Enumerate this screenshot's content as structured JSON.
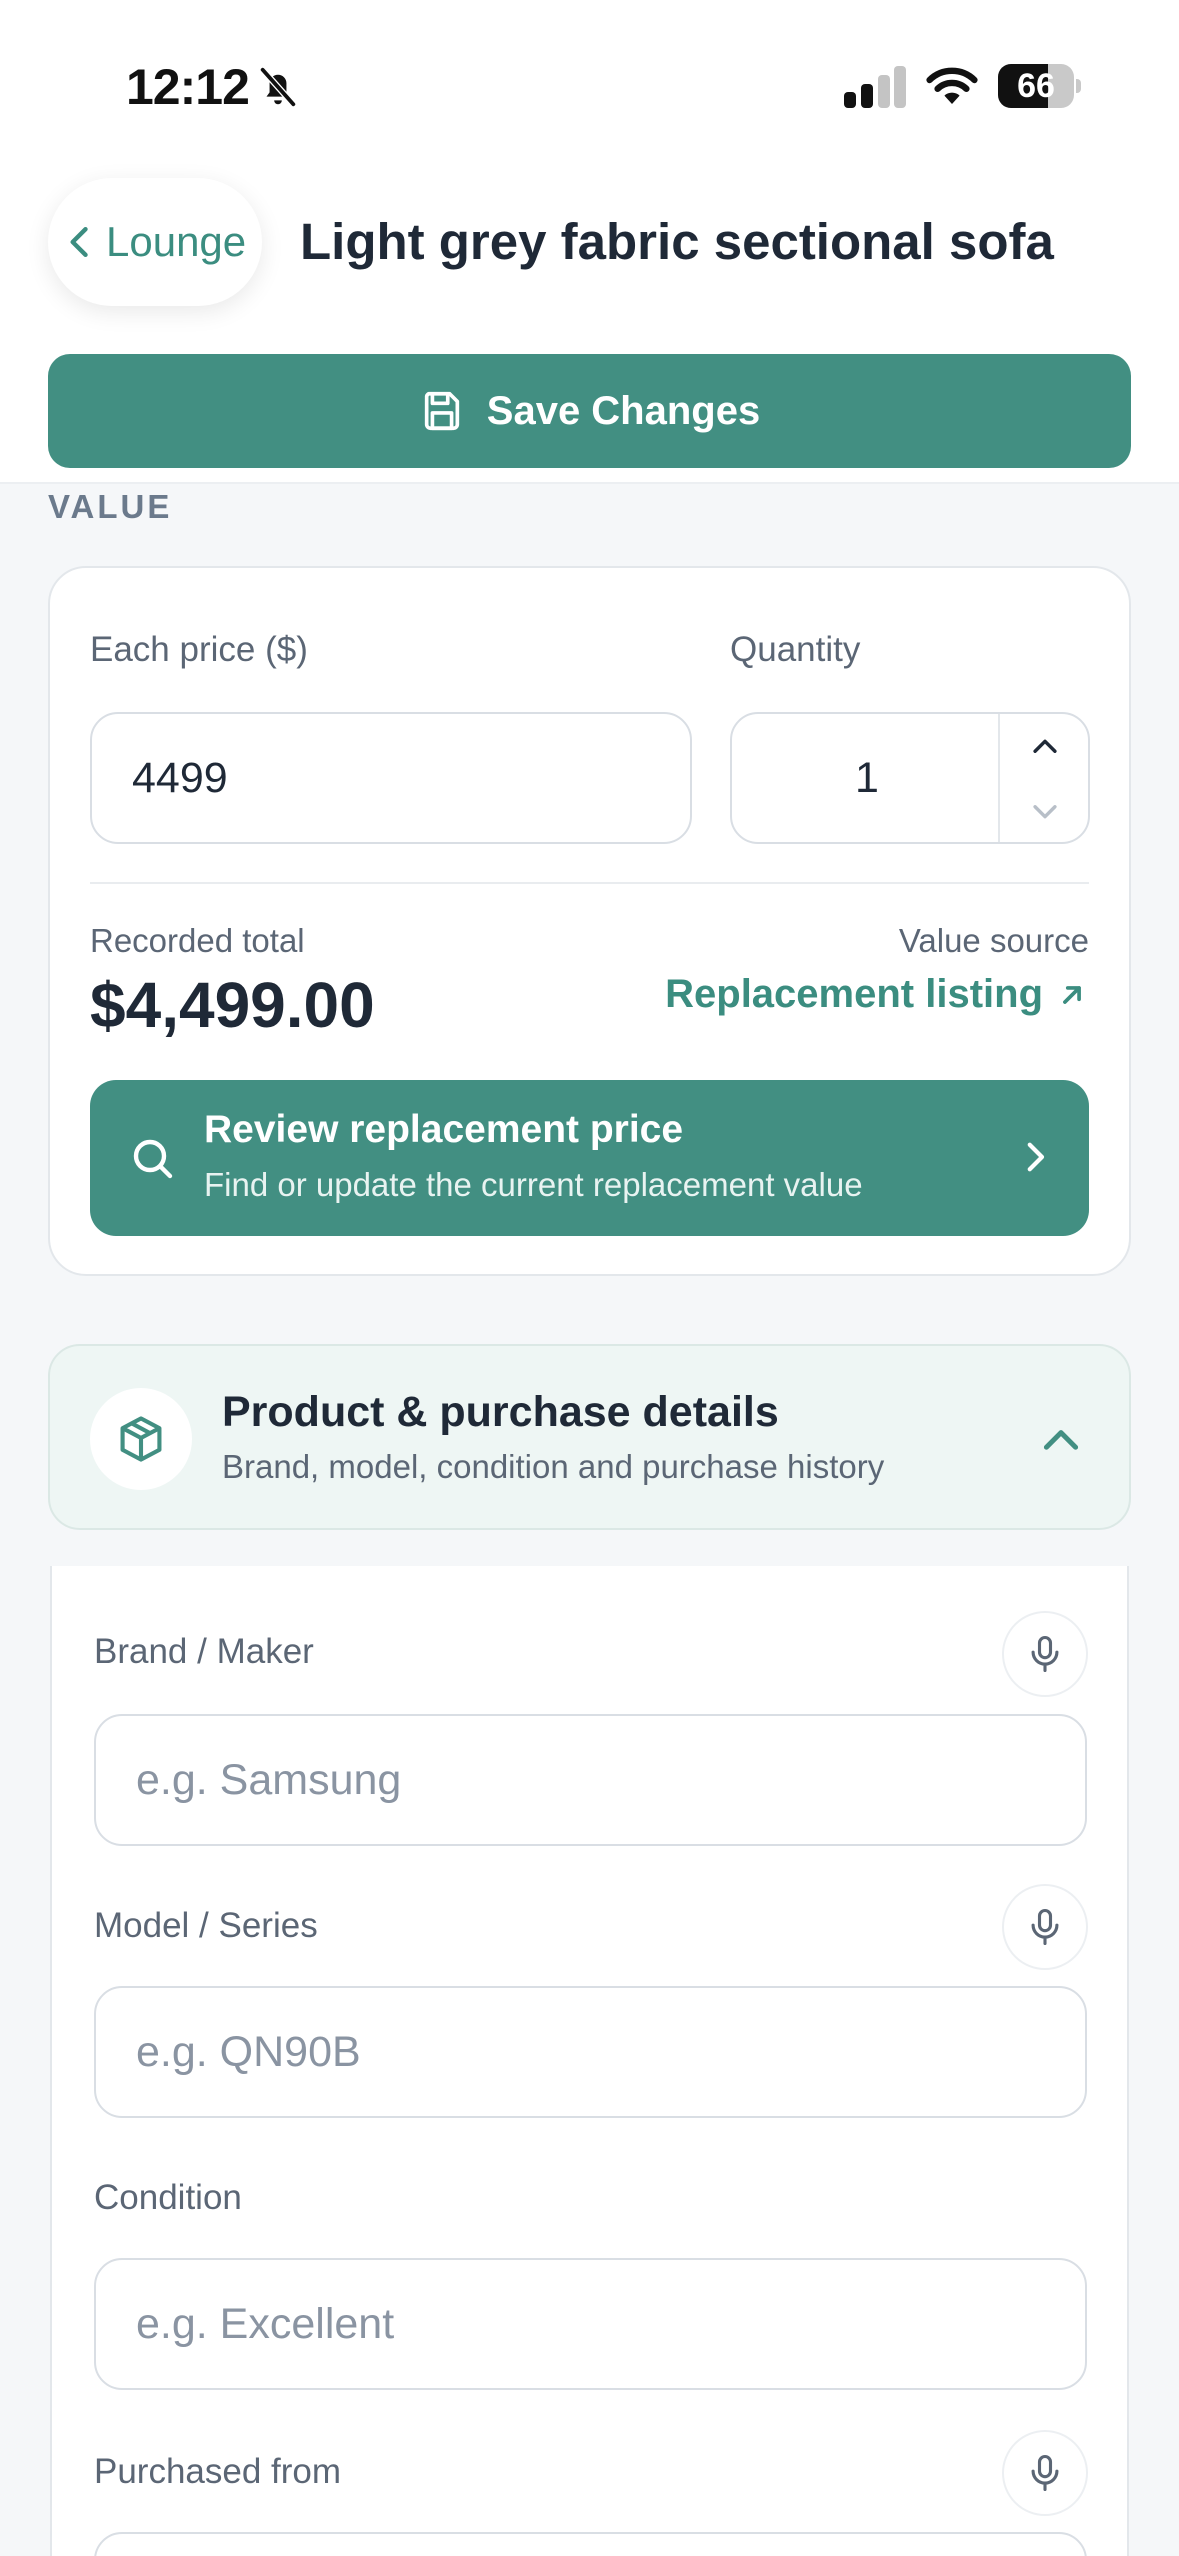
{
  "status_bar": {
    "time": "12:12",
    "battery_level": 66,
    "battery_text": "66"
  },
  "nav": {
    "back_label": "Lounge",
    "title": "Light grey fabric sectional sofa",
    "save_label": "Save Changes"
  },
  "value_section": {
    "label": "VALUE",
    "price_label": "Each price ($)",
    "price_value": "4499",
    "quantity_label": "Quantity",
    "quantity_value": "1",
    "total_label": "Recorded total",
    "total_value": "$4,499.00",
    "source_label": "Value source",
    "source_link": "Replacement listing",
    "review_title": "Review replacement price",
    "review_subtitle": "Find or update the current replacement value"
  },
  "details_section": {
    "title": "Product & purchase details",
    "subtitle": "Brand, model, condition and purchase history",
    "fields": [
      {
        "label": "Brand / Maker",
        "placeholder": "e.g. Samsung",
        "has_mic": true
      },
      {
        "label": "Model / Series",
        "placeholder": "e.g. QN90B",
        "has_mic": true
      },
      {
        "label": "Condition",
        "placeholder": "e.g. Excellent",
        "has_mic": false
      },
      {
        "label": "Purchased from",
        "placeholder": "",
        "has_mic": true
      }
    ]
  },
  "colors": {
    "accent": "#428f82",
    "accent_text": "#3b8d80",
    "details_bg": "#eef6f4",
    "page_bg": "#f5f7f9"
  },
  "icons": {
    "status": [
      "bell-slash-icon",
      "signal-icon",
      "wifi-icon",
      "battery-icon"
    ],
    "nav": [
      "chevron-left-icon",
      "floppy-disk-icon"
    ],
    "value": [
      "chevron-up-icon",
      "chevron-down-icon",
      "arrow-up-right-icon",
      "search-icon",
      "chevron-right-icon"
    ],
    "details": [
      "package-icon",
      "chevron-up-icon",
      "microphone-icon"
    ]
  }
}
